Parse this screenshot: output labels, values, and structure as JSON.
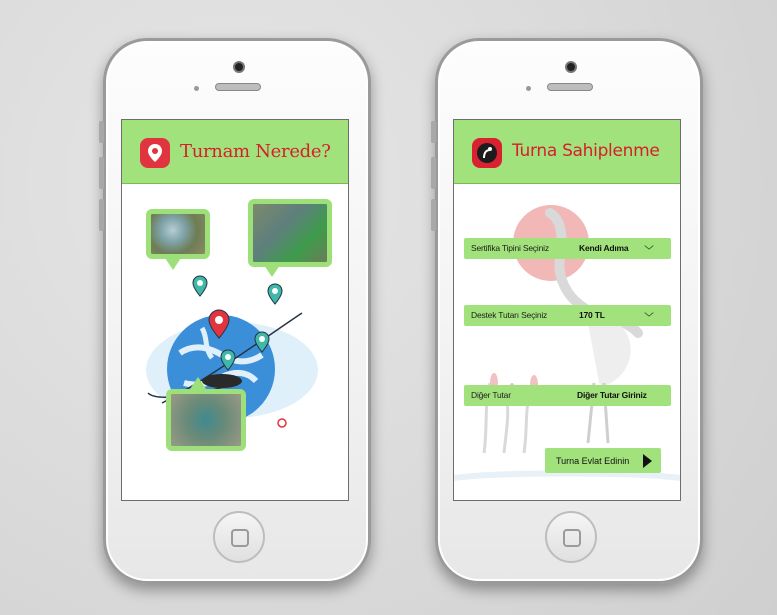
{
  "left_screen": {
    "title": "Turnam Nerede?",
    "icon": "location-pin-icon",
    "pins": [
      "map-pin-icon",
      "map-pin-icon",
      "map-pin-icon",
      "map-pin-icon",
      "location-pin-icon"
    ]
  },
  "right_screen": {
    "title": "Turna Sahiplenme",
    "icon": "crane-logo-icon",
    "rows": [
      {
        "label": "Sertifika Tipini Seçiniz",
        "value": "Kendi Adıma",
        "has_dropdown": true
      },
      {
        "label": "Destek Tutarı Seçiniz",
        "value": "170 TL",
        "has_dropdown": true
      },
      {
        "label": "Diğer Tutar",
        "value": "Diğer Tutar Giriniz",
        "has_dropdown": false
      }
    ],
    "cta": {
      "label": "Turna Evlat Edinin",
      "icon": "play-arrow-icon"
    }
  },
  "colors": {
    "header_green": "#a2e27c",
    "title_red": "#d61f2c",
    "globe_blue": "#3b8fd9",
    "flamingo_pink": "#f2b7b7"
  }
}
